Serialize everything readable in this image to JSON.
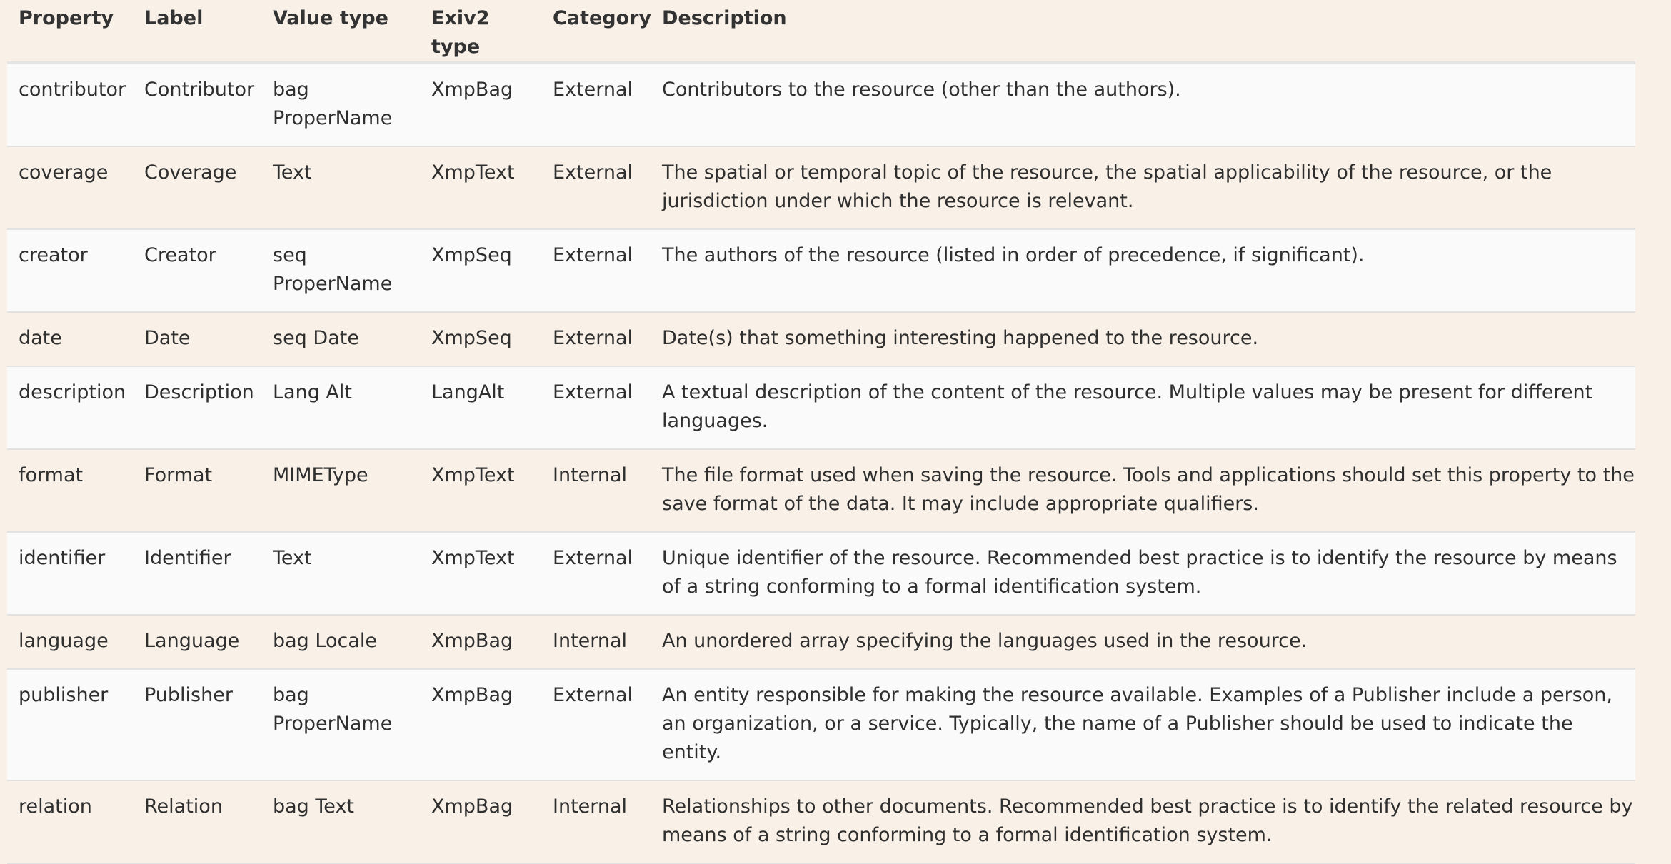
{
  "table": {
    "headers": [
      "Property",
      "Label",
      "Value type",
      "Exiv2 type",
      "Category",
      "Description"
    ],
    "rows": [
      {
        "property": "contributor",
        "label": "Contributor",
        "value_type": "bag ProperName",
        "exiv2_type": "XmpBag",
        "category": "External",
        "description": "Contributors to the resource (other than the authors)."
      },
      {
        "property": "coverage",
        "label": "Coverage",
        "value_type": "Text",
        "exiv2_type": "XmpText",
        "category": "External",
        "description": "The spatial or temporal topic of the resource, the spatial applicability of the resource, or the jurisdiction under which the resource is relevant."
      },
      {
        "property": "creator",
        "label": "Creator",
        "value_type": "seq ProperName",
        "exiv2_type": "XmpSeq",
        "category": "External",
        "description": "The authors of the resource (listed in order of precedence, if significant)."
      },
      {
        "property": "date",
        "label": "Date",
        "value_type": "seq Date",
        "exiv2_type": "XmpSeq",
        "category": "External",
        "description": "Date(s) that something interesting happened to the resource."
      },
      {
        "property": "description",
        "label": "Description",
        "value_type": "Lang Alt",
        "exiv2_type": "LangAlt",
        "category": "External",
        "description": "A textual description of the content of the resource. Multiple values may be present for different languages."
      },
      {
        "property": "format",
        "label": "Format",
        "value_type": "MIMEType",
        "exiv2_type": "XmpText",
        "category": "Internal",
        "description": "The file format used when saving the resource. Tools and applications should set this property to the save format of the data. It may include appropriate qualifiers."
      },
      {
        "property": "identifier",
        "label": "Identifier",
        "value_type": "Text",
        "exiv2_type": "XmpText",
        "category": "External",
        "description": "Unique identifier of the resource. Recommended best practice is to identify the resource by means of a string conforming to a formal identification system."
      },
      {
        "property": "language",
        "label": "Language",
        "value_type": "bag Locale",
        "exiv2_type": "XmpBag",
        "category": "Internal",
        "description": "An unordered array specifying the languages used in the resource."
      },
      {
        "property": "publisher",
        "label": "Publisher",
        "value_type": "bag ProperName",
        "exiv2_type": "XmpBag",
        "category": "External",
        "description": "An entity responsible for making the resource available. Examples of a Publisher include a person, an organization, or a service. Typically, the name of a Publisher should be used to indicate the entity."
      },
      {
        "property": "relation",
        "label": "Relation",
        "value_type": "bag Text",
        "exiv2_type": "XmpBag",
        "category": "Internal",
        "description": "Relationships to other documents. Recommended best practice is to identify the related resource by means of a string conforming to a formal identification system."
      }
    ]
  }
}
